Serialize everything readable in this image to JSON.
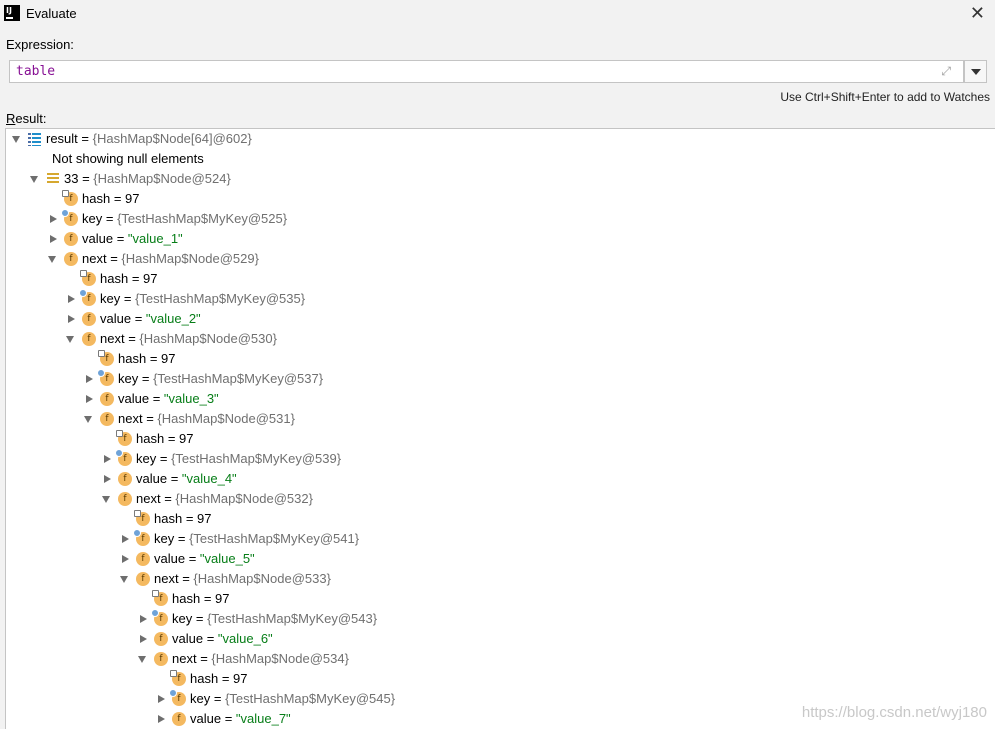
{
  "window": {
    "title": "Evaluate",
    "app_icon": "IJ",
    "close_icon": "close-icon"
  },
  "expression": {
    "label": "Expression:",
    "value": "table",
    "expand_icon": "expand-icon",
    "dropdown_icon": "chevron-down-icon"
  },
  "hint": "Use Ctrl+Shift+Enter to add to Watches",
  "result": {
    "label_first": "R",
    "label_rest": "esult:",
    "watermark": "https://blog.csdn.net/wyj180",
    "rows": [
      {
        "depth": 0,
        "toggle": "open",
        "icon": "list",
        "name": "result",
        "value": "{HashMap$Node[64]@602}",
        "kind": "type"
      },
      {
        "depth": 1,
        "toggle": "none",
        "icon": "none",
        "name": "Not showing null elements",
        "value": "",
        "kind": "msg"
      },
      {
        "depth": 1,
        "toggle": "open",
        "icon": "array",
        "name": "33",
        "value": "{HashMap$Node@524}",
        "kind": "type"
      },
      {
        "depth": 2,
        "toggle": "none",
        "icon": "fp",
        "name": "hash",
        "value": "97",
        "kind": "num"
      },
      {
        "depth": 2,
        "toggle": "closed",
        "icon": "fk",
        "name": "key",
        "value": "{TestHashMap$MyKey@525}",
        "kind": "type"
      },
      {
        "depth": 2,
        "toggle": "closed",
        "icon": "f",
        "name": "value",
        "value": "\"value_1\"",
        "kind": "str"
      },
      {
        "depth": 2,
        "toggle": "open",
        "icon": "f",
        "name": "next",
        "value": "{HashMap$Node@529}",
        "kind": "type"
      },
      {
        "depth": 3,
        "toggle": "none",
        "icon": "fp",
        "name": "hash",
        "value": "97",
        "kind": "num"
      },
      {
        "depth": 3,
        "toggle": "closed",
        "icon": "fk",
        "name": "key",
        "value": "{TestHashMap$MyKey@535}",
        "kind": "type"
      },
      {
        "depth": 3,
        "toggle": "closed",
        "icon": "f",
        "name": "value",
        "value": "\"value_2\"",
        "kind": "str"
      },
      {
        "depth": 3,
        "toggle": "open",
        "icon": "f",
        "name": "next",
        "value": "{HashMap$Node@530}",
        "kind": "type"
      },
      {
        "depth": 4,
        "toggle": "none",
        "icon": "fp",
        "name": "hash",
        "value": "97",
        "kind": "num"
      },
      {
        "depth": 4,
        "toggle": "closed",
        "icon": "fk",
        "name": "key",
        "value": "{TestHashMap$MyKey@537}",
        "kind": "type"
      },
      {
        "depth": 4,
        "toggle": "closed",
        "icon": "f",
        "name": "value",
        "value": "\"value_3\"",
        "kind": "str"
      },
      {
        "depth": 4,
        "toggle": "open",
        "icon": "f",
        "name": "next",
        "value": "{HashMap$Node@531}",
        "kind": "type"
      },
      {
        "depth": 5,
        "toggle": "none",
        "icon": "fp",
        "name": "hash",
        "value": "97",
        "kind": "num"
      },
      {
        "depth": 5,
        "toggle": "closed",
        "icon": "fk",
        "name": "key",
        "value": "{TestHashMap$MyKey@539}",
        "kind": "type"
      },
      {
        "depth": 5,
        "toggle": "closed",
        "icon": "f",
        "name": "value",
        "value": "\"value_4\"",
        "kind": "str"
      },
      {
        "depth": 5,
        "toggle": "open",
        "icon": "f",
        "name": "next",
        "value": "{HashMap$Node@532}",
        "kind": "type"
      },
      {
        "depth": 6,
        "toggle": "none",
        "icon": "fp",
        "name": "hash",
        "value": "97",
        "kind": "num"
      },
      {
        "depth": 6,
        "toggle": "closed",
        "icon": "fk",
        "name": "key",
        "value": "{TestHashMap$MyKey@541}",
        "kind": "type"
      },
      {
        "depth": 6,
        "toggle": "closed",
        "icon": "f",
        "name": "value",
        "value": "\"value_5\"",
        "kind": "str"
      },
      {
        "depth": 6,
        "toggle": "open",
        "icon": "f",
        "name": "next",
        "value": "{HashMap$Node@533}",
        "kind": "type"
      },
      {
        "depth": 7,
        "toggle": "none",
        "icon": "fp",
        "name": "hash",
        "value": "97",
        "kind": "num"
      },
      {
        "depth": 7,
        "toggle": "closed",
        "icon": "fk",
        "name": "key",
        "value": "{TestHashMap$MyKey@543}",
        "kind": "type"
      },
      {
        "depth": 7,
        "toggle": "closed",
        "icon": "f",
        "name": "value",
        "value": "\"value_6\"",
        "kind": "str"
      },
      {
        "depth": 7,
        "toggle": "open",
        "icon": "f",
        "name": "next",
        "value": "{HashMap$Node@534}",
        "kind": "type"
      },
      {
        "depth": 8,
        "toggle": "none",
        "icon": "fp",
        "name": "hash",
        "value": "97",
        "kind": "num"
      },
      {
        "depth": 8,
        "toggle": "closed",
        "icon": "fk",
        "name": "key",
        "value": "{TestHashMap$MyKey@545}",
        "kind": "type"
      },
      {
        "depth": 8,
        "toggle": "closed",
        "icon": "f",
        "name": "value",
        "value": "\"value_7\"",
        "kind": "str"
      }
    ]
  }
}
